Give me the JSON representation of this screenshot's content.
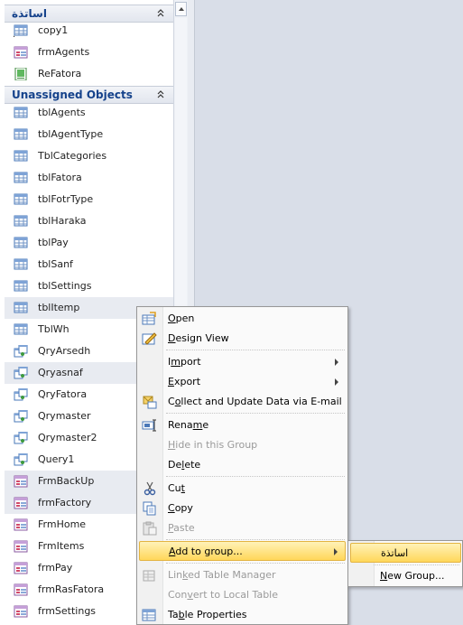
{
  "nav": {
    "groups": [
      {
        "title": "اساتذة",
        "items": [
          {
            "label": "copy1",
            "type": "table-link"
          },
          {
            "label": "frmAgents",
            "type": "form-link"
          },
          {
            "label": "ReFatora",
            "type": "report-link"
          }
        ]
      },
      {
        "title": "Unassigned Objects",
        "items": [
          {
            "label": "tblAgents",
            "type": "table"
          },
          {
            "label": "tblAgentType",
            "type": "table"
          },
          {
            "label": "TblCategories",
            "type": "table"
          },
          {
            "label": "tblFatora",
            "type": "table"
          },
          {
            "label": "tblFotrType",
            "type": "table"
          },
          {
            "label": "tblHaraka",
            "type": "table"
          },
          {
            "label": "tblPay",
            "type": "table"
          },
          {
            "label": "tblSanf",
            "type": "table"
          },
          {
            "label": "tblSettings",
            "type": "table"
          },
          {
            "label": "tblItemp",
            "type": "table"
          },
          {
            "label": "TblWh",
            "type": "table"
          },
          {
            "label": "QryArsedh",
            "type": "query"
          },
          {
            "label": "Qryasnaf",
            "type": "query"
          },
          {
            "label": "QryFatora",
            "type": "query"
          },
          {
            "label": "Qrymaster",
            "type": "query"
          },
          {
            "label": "Qrymaster2",
            "type": "query"
          },
          {
            "label": "Query1",
            "type": "query"
          },
          {
            "label": "FrmBackUp",
            "type": "form"
          },
          {
            "label": "frmFactory",
            "type": "form"
          },
          {
            "label": "FrmHome",
            "type": "form"
          },
          {
            "label": "FrmItems",
            "type": "form"
          },
          {
            "label": "frmPay",
            "type": "form"
          },
          {
            "label": "frmRasFatora",
            "type": "form"
          },
          {
            "label": "frmSettings",
            "type": "form"
          }
        ]
      }
    ]
  },
  "context_menu": {
    "items": [
      {
        "label": "Open",
        "icon": "open-icon"
      },
      {
        "label": "Design View",
        "icon": "design-view-icon"
      },
      {
        "label": "Import",
        "submenu": true
      },
      {
        "label": "Export",
        "submenu": true
      },
      {
        "label": "Collect and Update Data via E-mail",
        "icon": "collect-data-icon"
      },
      {
        "label": "Rename",
        "icon": "rename-icon"
      },
      {
        "label": "Hide in this Group",
        "disabled": true
      },
      {
        "label": "Delete"
      },
      {
        "label": "Cut",
        "icon": "cut-icon"
      },
      {
        "label": "Copy",
        "icon": "copy-icon"
      },
      {
        "label": "Paste",
        "icon": "paste-icon",
        "disabled": true
      },
      {
        "label": "Add to group...",
        "submenu": true,
        "selected": true
      },
      {
        "label": "Linked Table Manager",
        "icon": "linked-table-icon",
        "disabled": true
      },
      {
        "label": "Convert to Local Table",
        "disabled": true
      },
      {
        "label": "Table Properties",
        "icon": "table-properties-icon"
      }
    ]
  },
  "submenu": {
    "items": [
      {
        "label": "اساتذة",
        "selected": true
      },
      {
        "label": "New Group..."
      }
    ]
  },
  "colors": {
    "group_header_text": "#15428b",
    "highlight_gold": "#ffd75a",
    "right_pane_bg": "#d9dee8"
  }
}
